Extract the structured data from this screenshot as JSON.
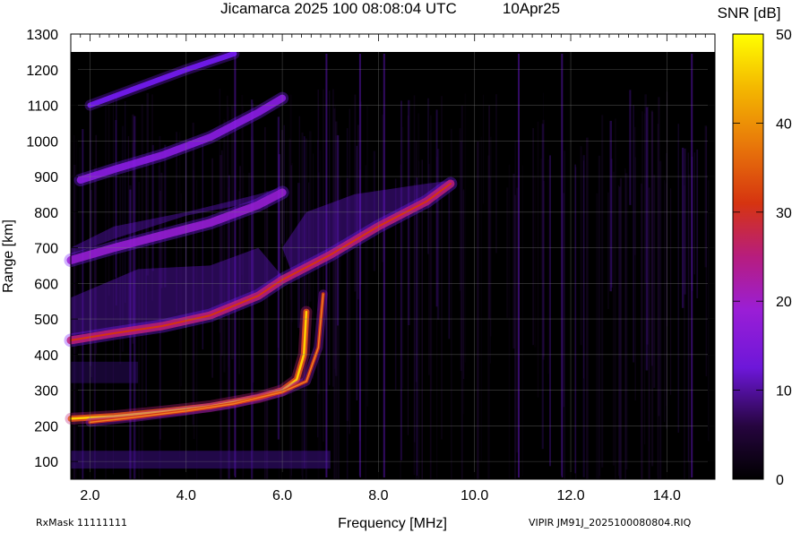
{
  "chart_data": {
    "type": "heatmap",
    "title": "Jicamarca 2025 100 08:08:04 UTC",
    "date_label": "10Apr25",
    "xlabel": "Frequency [MHz]",
    "ylabel": "Range [km]",
    "colorbar_label": "SNR [dB]",
    "xlim": [
      1.6,
      15.0
    ],
    "ylim": [
      50,
      1300
    ],
    "color_range": [
      0,
      50
    ],
    "x_ticks": [
      "2.0",
      "4.0",
      "6.0",
      "8.0",
      "10.0",
      "12.0",
      "14.0"
    ],
    "y_ticks": [
      "100",
      "200",
      "300",
      "400",
      "500",
      "600",
      "700",
      "800",
      "900",
      "1000",
      "1100",
      "1200",
      "1300"
    ],
    "colorbar_ticks": [
      "0",
      "10",
      "20",
      "30",
      "40",
      "50"
    ],
    "grid": true,
    "colormap": [
      "#000000",
      "#3a0a6b",
      "#7a1cff",
      "#c0207a",
      "#e8531a",
      "#f5a300",
      "#ffff00"
    ],
    "traces": [
      {
        "name_hint": "F-layer O-mode first hop",
        "points": [
          [
            1.6,
            220
          ],
          [
            2.5,
            227
          ],
          [
            3.5,
            240
          ],
          [
            4.5,
            255
          ],
          [
            5.5,
            280
          ],
          [
            6.0,
            300
          ],
          [
            6.3,
            330
          ],
          [
            6.45,
            400
          ],
          [
            6.5,
            520
          ]
        ]
      },
      {
        "name_hint": "F-layer X-mode first hop",
        "points": [
          [
            2.0,
            210
          ],
          [
            3.0,
            225
          ],
          [
            4.0,
            242
          ],
          [
            5.0,
            262
          ],
          [
            6.0,
            295
          ],
          [
            6.5,
            325
          ],
          [
            6.75,
            420
          ],
          [
            6.85,
            570
          ]
        ]
      },
      {
        "name_hint": "second hop",
        "points": [
          [
            1.6,
            440
          ],
          [
            2.5,
            460
          ],
          [
            3.5,
            480
          ],
          [
            4.5,
            510
          ],
          [
            5.5,
            565
          ],
          [
            6.0,
            610
          ],
          [
            7.0,
            680
          ],
          [
            8.0,
            760
          ],
          [
            9.0,
            830
          ],
          [
            9.5,
            880
          ]
        ]
      },
      {
        "name_hint": "third hop",
        "points": [
          [
            1.6,
            665
          ],
          [
            2.5,
            700
          ],
          [
            3.5,
            735
          ],
          [
            4.5,
            770
          ],
          [
            5.5,
            820
          ],
          [
            6.0,
            855
          ]
        ]
      },
      {
        "name_hint": "fourth hop",
        "points": [
          [
            1.8,
            890
          ],
          [
            2.5,
            920
          ],
          [
            3.5,
            960
          ],
          [
            4.5,
            1010
          ],
          [
            5.5,
            1080
          ],
          [
            6.0,
            1120
          ]
        ]
      },
      {
        "name_hint": "fifth hop",
        "points": [
          [
            2.0,
            1100
          ],
          [
            3.0,
            1150
          ],
          [
            4.0,
            1200
          ],
          [
            5.0,
            1245
          ]
        ]
      }
    ]
  },
  "footer": {
    "rx_mask": "RxMask 11111111",
    "filename": "VIPIR  JM91J_2025100080804.RIQ"
  }
}
